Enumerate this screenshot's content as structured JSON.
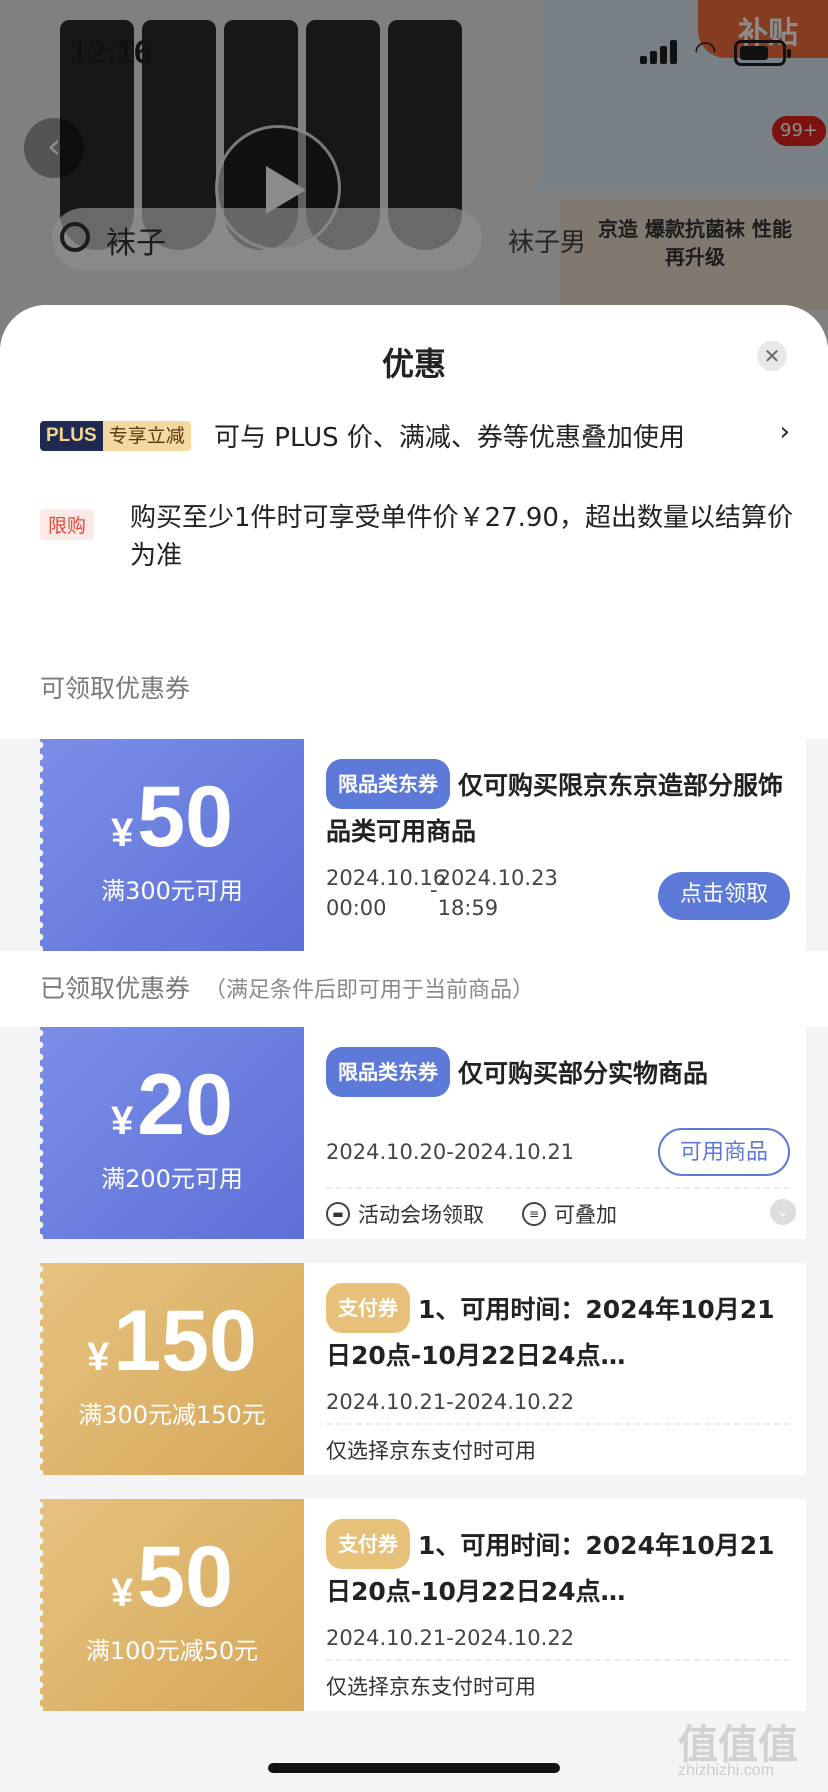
{
  "status_bar": {
    "time": "12:16"
  },
  "background": {
    "subsidy_badge": "补贴",
    "search_text": "袜子",
    "search_hint": "袜子男",
    "side_text": "京造 爆款抗菌袜 性能再升级",
    "cart_badge": "99+"
  },
  "sheet": {
    "title": "优惠",
    "close_icon": "close-icon"
  },
  "plus": {
    "badge_plus": "PLUS",
    "badge_label": "专享立减",
    "text": "可与 PLUS 价、满减、券等优惠叠加使用",
    "arrow": "›"
  },
  "limit": {
    "badge": "限购",
    "text": "购买至少1件时可享受单件价￥27.90，超出数量以结算价为准"
  },
  "sections": {
    "available": "可领取优惠券",
    "claimed": "已领取优惠券",
    "claimed_sub": "（满足条件后即可用于当前商品）"
  },
  "coupons": [
    {
      "currency": "¥",
      "amount": "50",
      "condition": "满300元可用",
      "tag": "限品类东券",
      "title": "仅可购买限京东京造部分服饰品类可用商品",
      "date_start": "2024.10.16 00:00",
      "date_sep": "-",
      "date_end": "2024.10.23 18:59",
      "button": "点击领取"
    },
    {
      "currency": "¥",
      "amount": "20",
      "condition": "满200元可用",
      "tag": "限品类东券",
      "title": "仅可购买部分实物商品",
      "date": "2024.10.20-2024.10.21",
      "button": "可用商品",
      "meta1": "活动会场领取",
      "meta2": "可叠加"
    },
    {
      "currency": "¥",
      "amount": "150",
      "condition": "满300元减150元",
      "tag": "支付券",
      "title": "1、可用时间：2024年10月21日20点-10月22日24点…",
      "date": "2024.10.21-2024.10.22",
      "note": "仅选择京东支付时可用"
    },
    {
      "currency": "¥",
      "amount": "50",
      "condition": "满100元减50元",
      "tag": "支付券",
      "title": "1、可用时间：2024年10月21日20点-10月22日24点…",
      "date": "2024.10.21-2024.10.22",
      "note": "仅选择京东支付时可用"
    }
  ],
  "watermark": {
    "text": "值值值",
    "url": "zhizhizhi.com"
  },
  "colors": {
    "blue": "#5d7ad8",
    "gold": "#d6a85a",
    "red": "#e24a35"
  }
}
